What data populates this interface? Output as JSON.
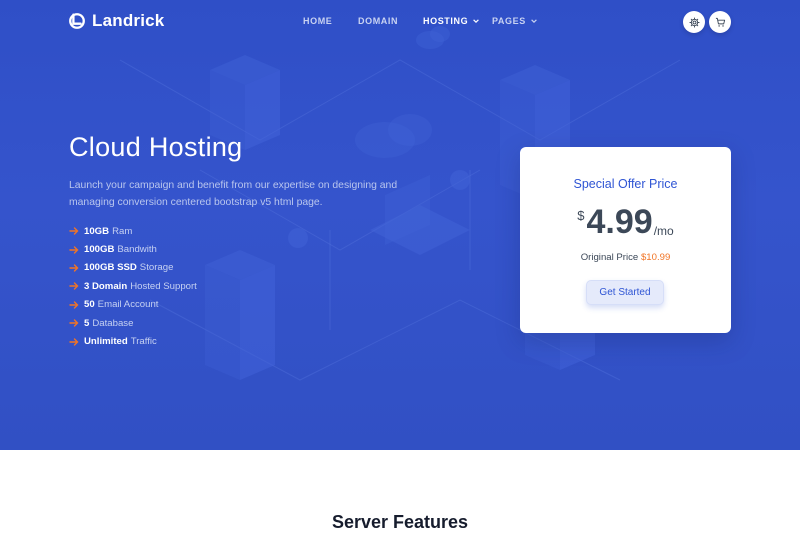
{
  "brand": {
    "name": "Landrick"
  },
  "nav": {
    "items": [
      {
        "label": "HOME",
        "active": false,
        "dropdown": false
      },
      {
        "label": "DOMAIN",
        "active": false,
        "dropdown": false
      },
      {
        "label": "HOSTING",
        "active": true,
        "dropdown": true
      },
      {
        "label": "PAGES",
        "active": false,
        "dropdown": true
      }
    ],
    "icons": [
      "gear-icon",
      "cart-icon"
    ]
  },
  "hero": {
    "title": "Cloud Hosting",
    "description": "Launch your campaign and benefit from our expertise on designing and managing conversion centered bootstrap v5 html page.",
    "features": [
      {
        "bold": "10GB",
        "text": "Ram"
      },
      {
        "bold": "100GB",
        "text": "Bandwith"
      },
      {
        "bold": "100GB SSD",
        "text": "Storage"
      },
      {
        "bold": "3 Domain",
        "text": "Hosted Support"
      },
      {
        "bold": "50",
        "text": "Email Account"
      },
      {
        "bold": "5",
        "text": "Database"
      },
      {
        "bold": "Unlimited",
        "text": "Traffic"
      }
    ]
  },
  "offer": {
    "title": "Special Offer Price",
    "currency": "$",
    "amount": "4.99",
    "period": "/mo",
    "original_label": "Original Price",
    "original_price": "$10.99",
    "button_label": "Get Started"
  },
  "section": {
    "title": "Server Features"
  },
  "colors": {
    "hero_bg": "#3554cc",
    "primary": "#2f55d4",
    "accent_orange": "#f17425",
    "text_dark": "#3c4858"
  }
}
